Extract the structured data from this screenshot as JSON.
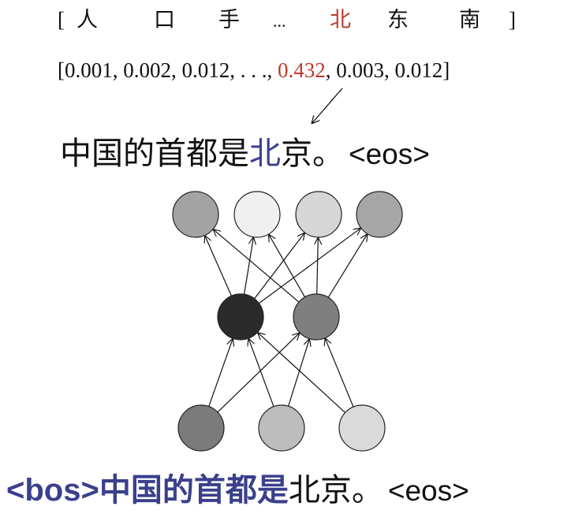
{
  "vocab_row": {
    "open_bracket": "[",
    "tokens": [
      "人",
      "口",
      "手",
      "...",
      "北",
      "东",
      "南"
    ],
    "close_bracket": "]",
    "highlight_index": 4
  },
  "prob_row": {
    "open_bracket": "[",
    "values": [
      "0.001",
      "0.002",
      "0.012",
      ". . .",
      "0.432",
      "0.003",
      "0.012"
    ],
    "close_bracket": "]",
    "highlight_index": 4
  },
  "output_sentence": {
    "tokens": [
      "中国的首都是",
      "北",
      "京。",
      "<eos>"
    ],
    "highlight_index": 1
  },
  "input_sentence": {
    "tokens": [
      "<bos>",
      "中国的首都是",
      "北京。",
      "<eos>"
    ],
    "blue_indices": [
      0,
      1
    ]
  },
  "network": {
    "output_node_shades": [
      "#a3a3a3",
      "#f0f0f0",
      "#d6d6d6",
      "#a6a6a6"
    ],
    "hidden_node_shades": [
      "#2b2b2b",
      "#7f7f7f"
    ],
    "input_node_shades": [
      "#7b7b7b",
      "#bdbdbd",
      "#dadada"
    ]
  },
  "colors": {
    "highlight_red": "#c0392b",
    "highlight_blue": "#3b3f8c",
    "text": "#111111"
  }
}
